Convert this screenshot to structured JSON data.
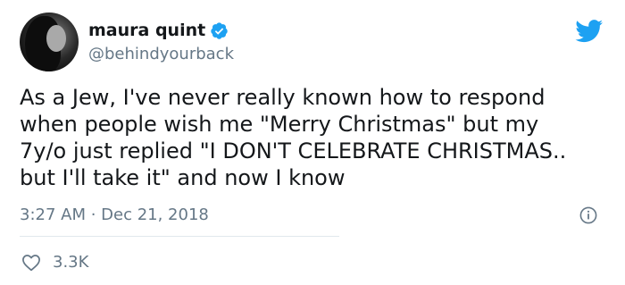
{
  "author": {
    "name": "maura quint",
    "handle": "@behindyourback",
    "verified": true
  },
  "tweet": {
    "lines": [
      "As a Jew, I've never really known how to respond",
      "when people wish me \"Merry Christmas\" but my",
      "7y/o just replied \"I DON'T CELEBRATE CHRISTMAS..",
      "but I'll take it\" and now I know"
    ],
    "timestamp": "3:27 AM · Dec 21, 2018",
    "likes": "3.3K"
  },
  "icons": {
    "brand": "twitter-bird-icon",
    "verified": "verified-badge-icon",
    "info": "info-icon",
    "like": "heart-icon"
  },
  "colors": {
    "brand": "#1da1f2",
    "text": "#14171a",
    "secondary": "#657786",
    "divider": "#e1e8ed"
  }
}
